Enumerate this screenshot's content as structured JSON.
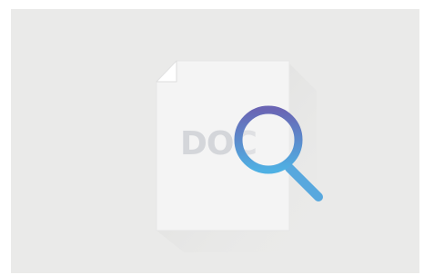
{
  "illustration": {
    "document_icon": "document-icon",
    "magnifier_icon": "magnifying-glass-icon",
    "document_text": "DOC",
    "colors": {
      "background": "#eaeae9",
      "page": "#f5f5f5",
      "page_shadow": "#dcdcdb",
      "fold": "#ffffff",
      "lens_gradient_top": "#6a65b4",
      "lens_gradient_bottom": "#53a6de",
      "handle": "#58a8de"
    }
  }
}
